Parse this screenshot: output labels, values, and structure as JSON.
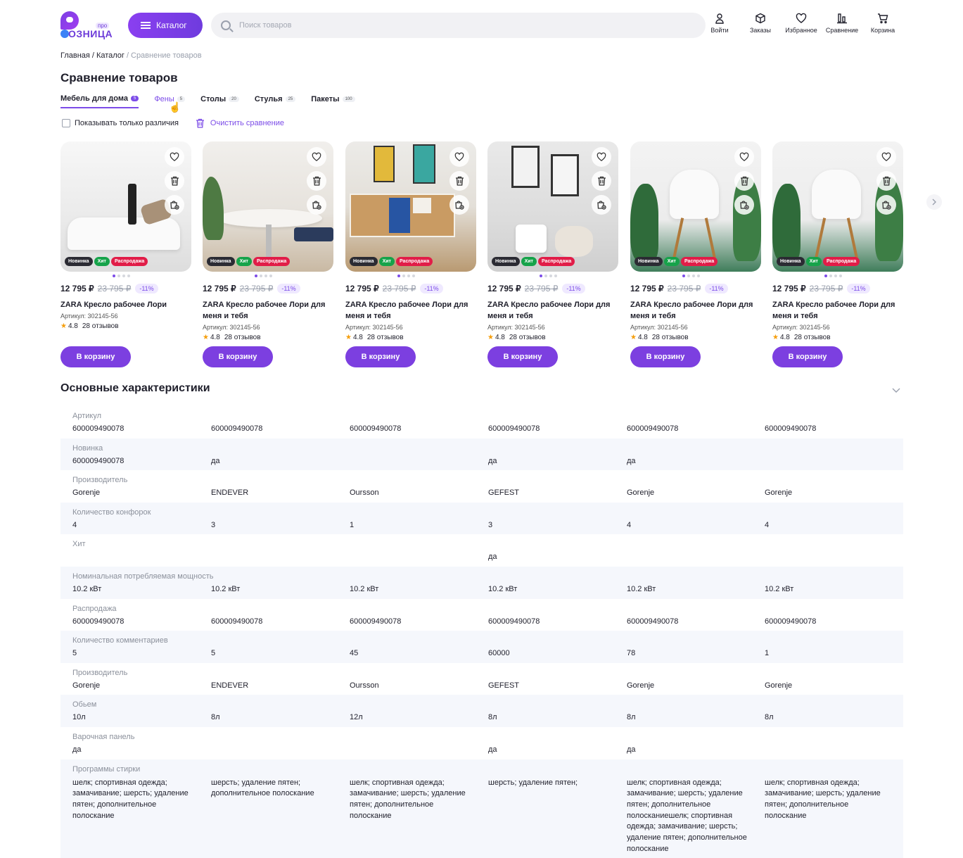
{
  "header": {
    "logo_text": "ОЗНИЦА",
    "logo_badge": "про",
    "catalog_label": "Каталог",
    "search_placeholder": "Поиск товаров",
    "actions": [
      {
        "label": "Войти",
        "icon": "user-icon"
      },
      {
        "label": "Заказы",
        "icon": "box-icon"
      },
      {
        "label": "Избранное",
        "icon": "heart-icon"
      },
      {
        "label": "Сравнение",
        "icon": "compare-icon"
      },
      {
        "label": "Корзина",
        "icon": "cart-icon"
      }
    ]
  },
  "breadcrumb": {
    "items": [
      "Главная",
      "Каталог"
    ],
    "current": "Сравнение товаров"
  },
  "page_title": "Сравнение товаров",
  "tabs": [
    {
      "label": "Мебель для дома",
      "count": "5"
    },
    {
      "label": "Фены",
      "count": "5"
    },
    {
      "label": "Столы",
      "count": "20"
    },
    {
      "label": "Стулья",
      "count": "25"
    },
    {
      "label": "Пакеты",
      "count": "100"
    }
  ],
  "filters": {
    "only_diff_label": "Показывать только различия",
    "clear_label": "Очистить сравнение"
  },
  "products": [
    {
      "price": "12 795 ₽",
      "old_price": "23 795 ₽",
      "discount": "-11%",
      "name": "ZARA Кресло рабочее Лори",
      "sku": "Артикул: 302145-56",
      "rating": "4.8",
      "reviews": "28 отзывов",
      "cart": "В корзину",
      "badges": [
        "Новинка",
        "Хит",
        "Распродажа"
      ]
    },
    {
      "price": "12 795 ₽",
      "old_price": "23 795 ₽",
      "discount": "-11%",
      "name": "ZARA Кресло рабочее Лори для меня и тебя",
      "sku": "Артикул: 302145-56",
      "rating": "4.8",
      "reviews": "28 отзывов",
      "cart": "В корзину",
      "badges": [
        "Новинка",
        "Хит",
        "Распродажа"
      ]
    },
    {
      "price": "12 795 ₽",
      "old_price": "23 795 ₽",
      "discount": "-11%",
      "name": "ZARA Кресло рабочее Лори для меня и тебя",
      "sku": "Артикул: 302145-56",
      "rating": "4.8",
      "reviews": "28 отзывов",
      "cart": "В корзину",
      "badges": [
        "Новинка",
        "Хит",
        "Распродажа"
      ]
    },
    {
      "price": "12 795 ₽",
      "old_price": "23 795 ₽",
      "discount": "-11%",
      "name": "ZARA Кресло рабочее Лори для меня и тебя",
      "sku": "Артикул: 302145-56",
      "rating": "4.8",
      "reviews": "28 отзывов",
      "cart": "В корзину",
      "badges": [
        "Новинка",
        "Хит",
        "Распродажа"
      ]
    },
    {
      "price": "12 795 ₽",
      "old_price": "23 795 ₽",
      "discount": "-11%",
      "name": "ZARA Кресло рабочее Лори для меня и тебя",
      "sku": "Артикул: 302145-56",
      "rating": "4.8",
      "reviews": "28 отзывов",
      "cart": "В корзину",
      "badges": [
        "Новинка",
        "Хит",
        "Распродажа"
      ]
    },
    {
      "price": "12 795 ₽",
      "old_price": "23 795 ₽",
      "discount": "-11%",
      "name": "ZARA Кресло рабочее Лори для меня и тебя",
      "sku": "Артикул: 302145-56",
      "rating": "4.8",
      "reviews": "28 отзывов",
      "cart": "В корзину",
      "badges": [
        "Новинка",
        "Хит",
        "Распродажа"
      ]
    }
  ],
  "specs": {
    "title": "Основные характеристики",
    "rows": [
      {
        "label": "Артикул",
        "values": [
          "600009490078",
          "600009490078",
          "600009490078",
          "600009490078",
          "600009490078",
          "600009490078"
        ]
      },
      {
        "label": "Новинка",
        "values": [
          "600009490078",
          "да",
          "",
          "да",
          "да",
          ""
        ]
      },
      {
        "label": "Производитель",
        "values": [
          "Gorenje",
          "ENDEVER",
          "Oursson",
          "GEFEST",
          "Gorenje",
          "Gorenje"
        ]
      },
      {
        "label": "Количество конфорок",
        "values": [
          "4",
          "3",
          "1",
          "3",
          "4",
          "4"
        ]
      },
      {
        "label": "Хит",
        "values": [
          "",
          "",
          "",
          "да",
          "",
          ""
        ]
      },
      {
        "label": "Номинальная потребляемая мощность",
        "values": [
          "10.2 кВт",
          "10.2 кВт",
          "10.2 кВт",
          "10.2 кВт",
          "10.2 кВт",
          "10.2 кВт"
        ]
      },
      {
        "label": "Распродажа",
        "values": [
          "600009490078",
          "600009490078",
          "600009490078",
          "600009490078",
          "600009490078",
          "600009490078"
        ]
      },
      {
        "label": "Количество комментариев",
        "values": [
          "5",
          "5",
          "45",
          "60000",
          "78",
          "1"
        ]
      },
      {
        "label": "Производитель",
        "values": [
          "Gorenje",
          "ENDEVER",
          "Oursson",
          "GEFEST",
          "Gorenje",
          "Gorenje"
        ]
      },
      {
        "label": "Обьем",
        "values": [
          "10л",
          "8л",
          "12л",
          "8л",
          "8л",
          "8л"
        ]
      },
      {
        "label": "Варочная панель",
        "values": [
          "да",
          "",
          "",
          "да",
          "да",
          ""
        ]
      },
      {
        "label": "Программы стирки",
        "values": [
          "шелк; спортивная одежда; замачивание; шерсть; удаление пятен; дополнительное полоскание",
          "шерсть; удаление пятен; дополнительное полоскание",
          "шелк; спортивная одежда; замачивание; шерсть; удаление пятен; дополнительное полоскание",
          "шерсть; удаление пятен;",
          "шелк; спортивная одежда; замачивание; шерсть; удаление пятен; дополнительное полосканиешелк; спортивная одежда; замачивание; шерсть; удаление пятен; дополнительное полоскание",
          "шелк; спортивная одежда; замачивание; шерсть; удаление пятен; дополнительное полоскание"
        ]
      }
    ]
  }
}
